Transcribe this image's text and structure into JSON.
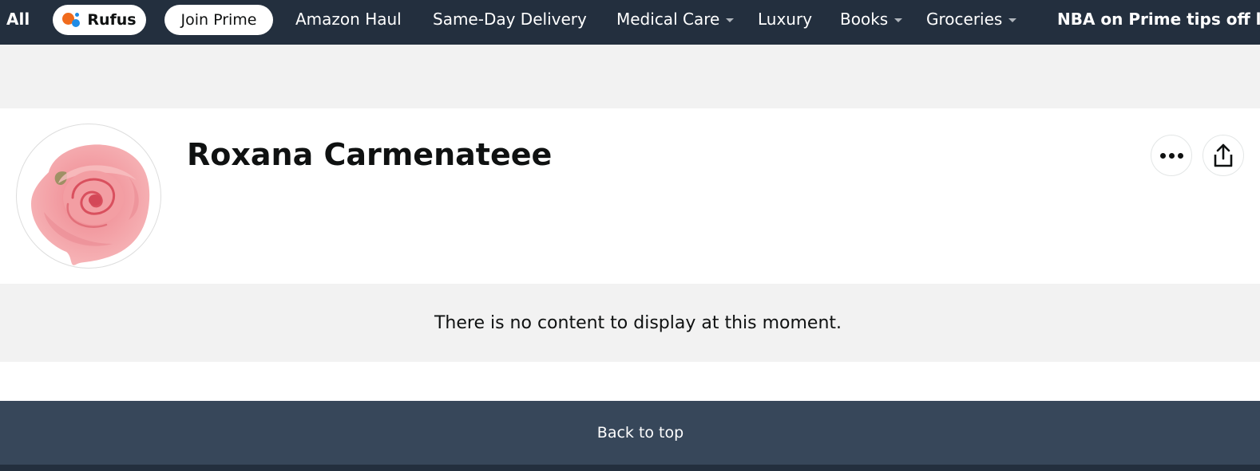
{
  "nav": {
    "all_label": "All",
    "rufus_label": "Rufus",
    "prime_label": "Join Prime",
    "links": [
      "Amazon Haul",
      "Same-Day Delivery",
      "Medical Care",
      "Luxury",
      "Books",
      "Groceries"
    ],
    "promo": "NBA on Prime tips off l"
  },
  "profile": {
    "name": "Roxana Carmenateee",
    "avatar_icon": "rose-icon"
  },
  "content": {
    "empty_message": "There is no content to display at this moment."
  },
  "footer": {
    "back_to_top": "Back to top"
  },
  "colors": {
    "nav_bg": "#232f3e",
    "back_to_top_bg": "#37475a",
    "page_gray": "#f2f2f2",
    "rufus_orange": "#f06b1d",
    "rufus_blue": "#1f8ce6"
  }
}
